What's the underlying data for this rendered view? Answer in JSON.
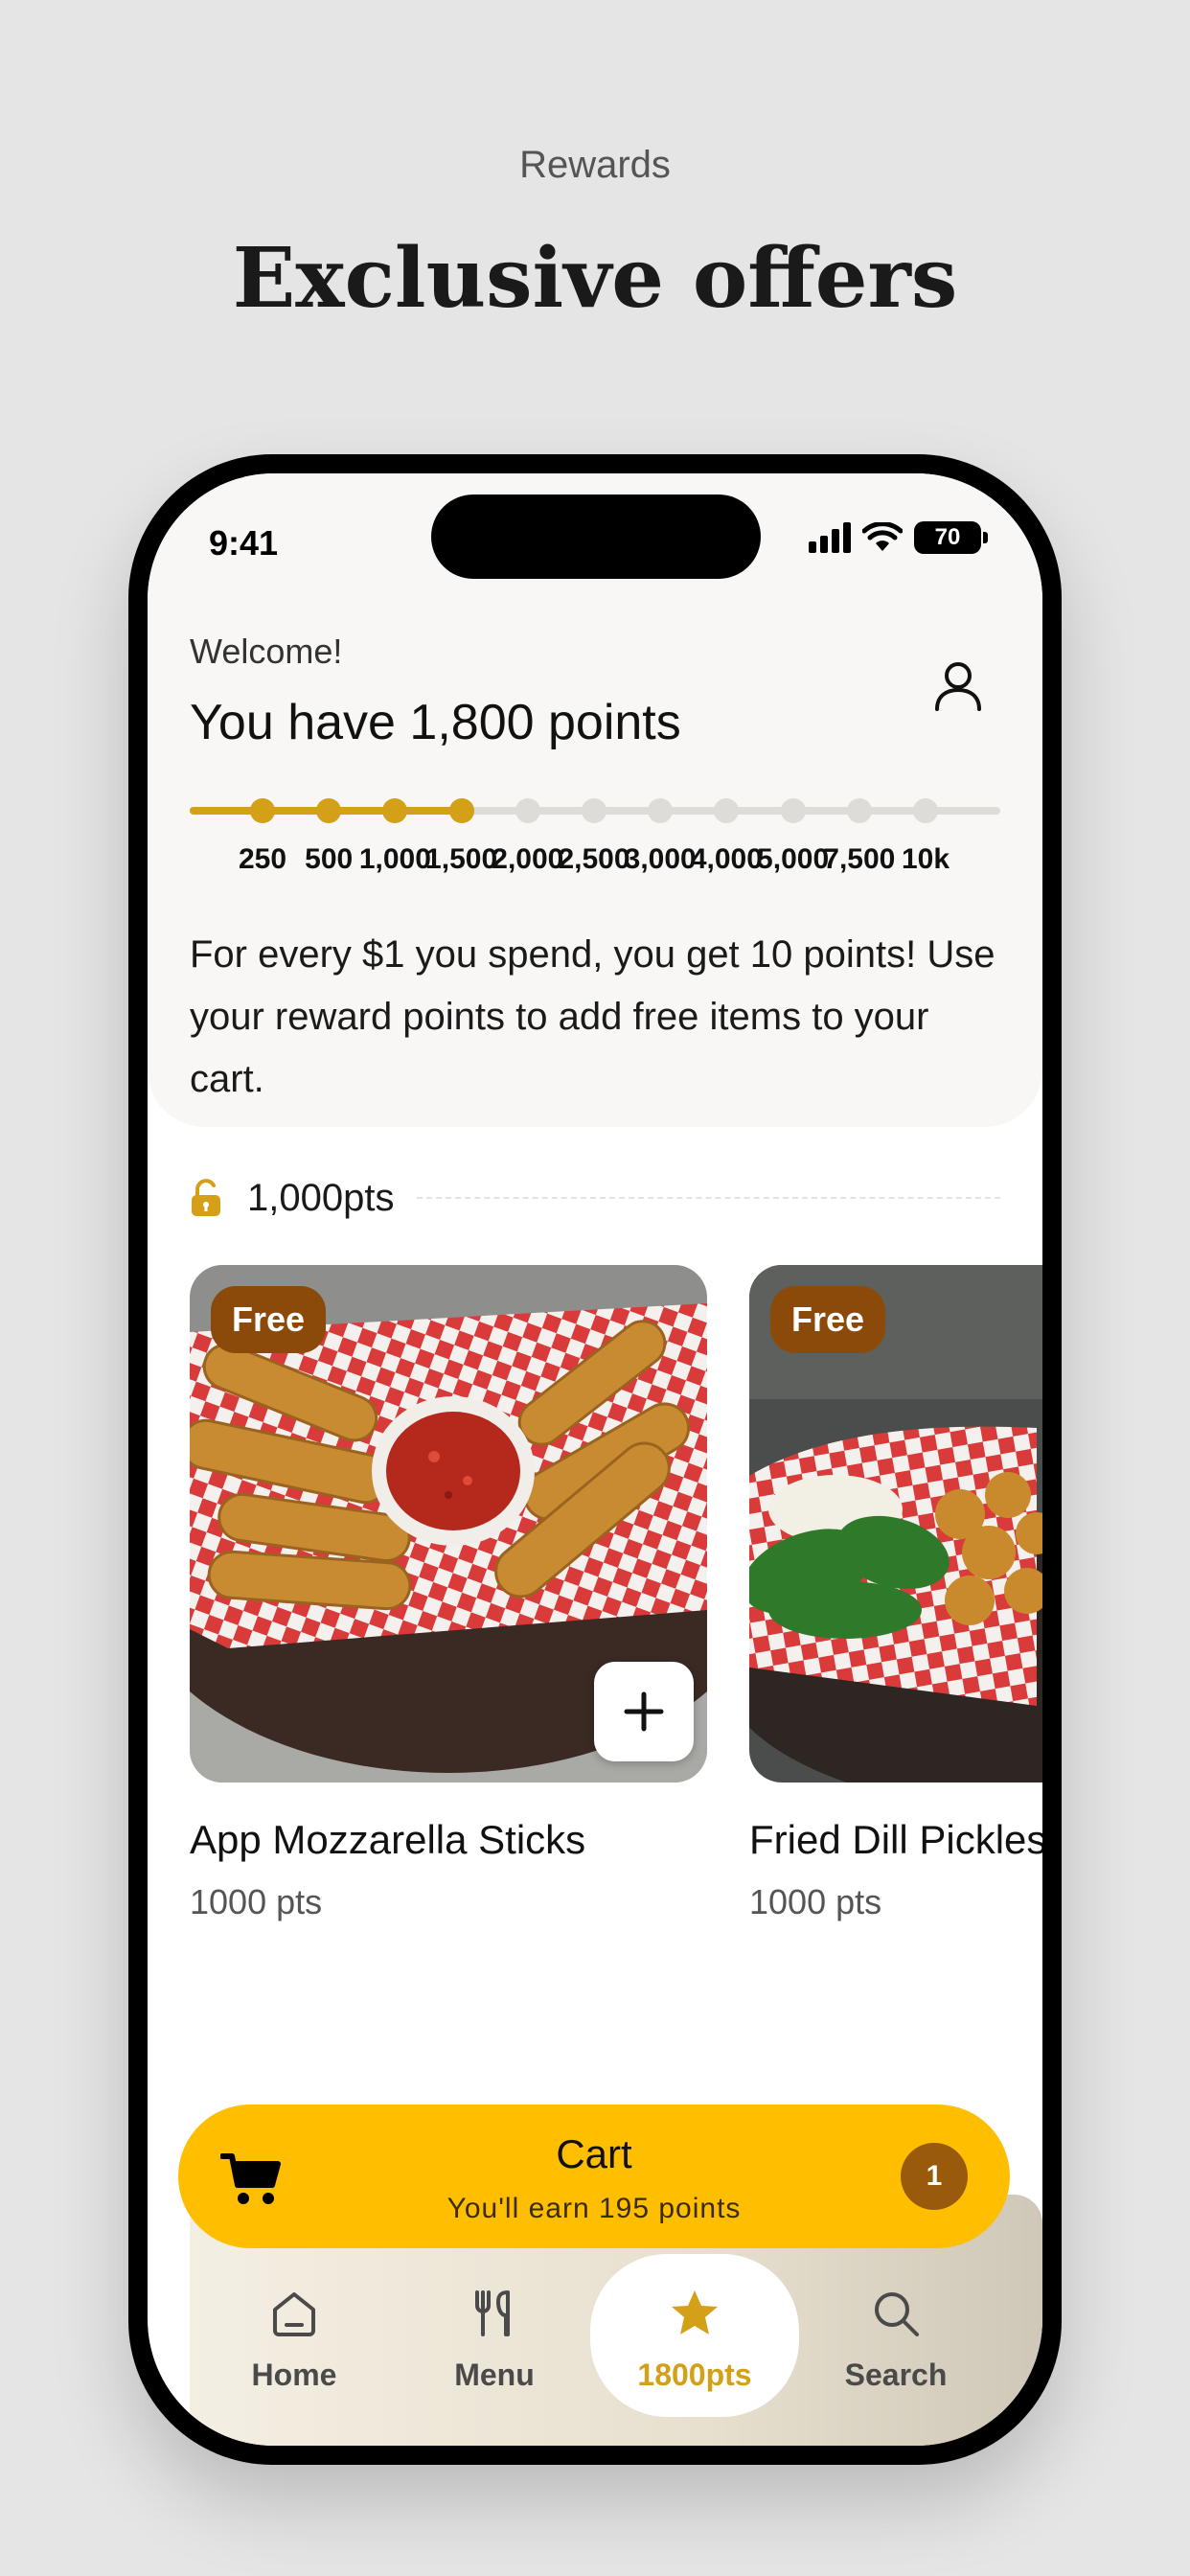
{
  "promo": {
    "eyebrow": "Rewards",
    "title": "Exclusive offers"
  },
  "status_bar": {
    "time": "9:41",
    "battery": "70"
  },
  "header": {
    "welcome": "Welcome!",
    "points_heading": "You have 1,800 points"
  },
  "progress": {
    "current_points": 1800,
    "milestones": [
      "250",
      "500",
      "1,000",
      "1,500",
      "2,000",
      "2,500",
      "3,000",
      "4,000",
      "5,000",
      "7,500",
      "10k"
    ],
    "milestones_reached": 4
  },
  "info": {
    "text": "For every $1 you spend, you get 10 points! Use your reward points to add free items to your cart."
  },
  "section": {
    "points": "1,000pts"
  },
  "items": [
    {
      "badge": "Free",
      "name": "App Mozzarella Sticks",
      "points": "1000 pts"
    },
    {
      "badge": "Free",
      "name": "Fried Dill Pickles",
      "points": "1000 pts"
    }
  ],
  "cart": {
    "title": "Cart",
    "subtitle": "You'll earn 195 points",
    "count": "1"
  },
  "tabs": [
    {
      "label": "Home",
      "icon": "home-icon"
    },
    {
      "label": "Menu",
      "icon": "utensils-icon"
    },
    {
      "label": "1800pts",
      "icon": "star-icon",
      "active": true
    },
    {
      "label": "Search",
      "icon": "search-icon"
    }
  ],
  "colors": {
    "accent": "#d4a017",
    "cart_bar": "#ffbe00",
    "badge": "#8b4a0a"
  }
}
